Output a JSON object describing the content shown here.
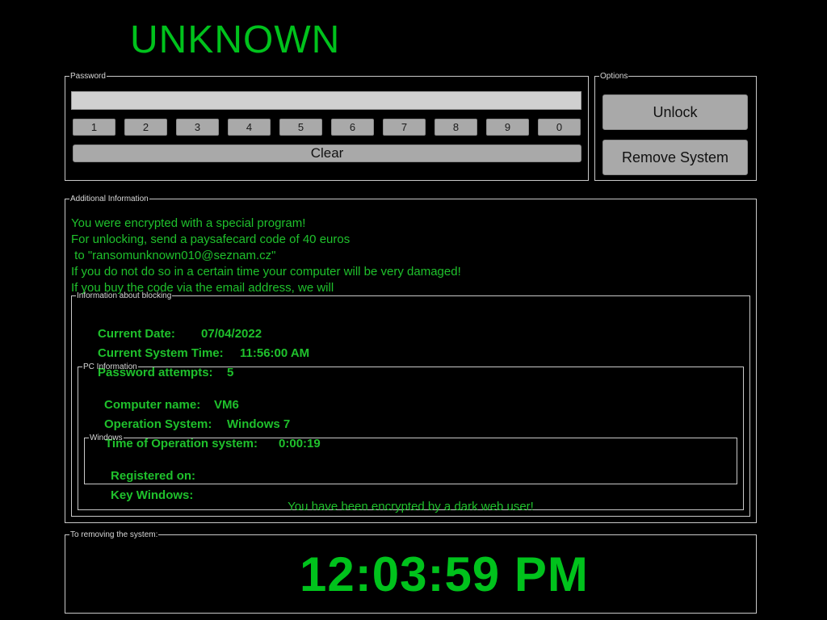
{
  "title": "UNKNOWN",
  "password": {
    "legend": "Password",
    "value": "",
    "digits": [
      "1",
      "2",
      "3",
      "4",
      "5",
      "6",
      "7",
      "8",
      "9",
      "0"
    ],
    "clear_label": "Clear"
  },
  "options": {
    "legend": "Options",
    "unlock_label": "Unlock",
    "remove_label": "Remove System"
  },
  "additional": {
    "legend": "Additional Information",
    "lines": [
      "You were encrypted with a special program!",
      "For unlocking, send a paysafecard code of 40 euros",
      " to \"ransomunknown010@seznam.cz\"",
      "If you do not do so in a certain time your computer will be very damaged!",
      "If you buy the code via the email address, we will"
    ]
  },
  "blocking": {
    "legend": "Information about blocking",
    "current_date_label": "Current Date:",
    "current_date": "07/04/2022",
    "system_time_label": "Current System Time:",
    "system_time": "11:56:00 AM",
    "attempts_label": "Password attempts:",
    "attempts": "5"
  },
  "pc": {
    "legend": "PC Information",
    "computer_name_label": "Computer name:",
    "computer_name": "VM6",
    "os_label": "Operation System:",
    "os": "Windows 7",
    "uptime_label": "Time of Operation system:",
    "uptime": "0:00:19"
  },
  "windows": {
    "legend": "Windows",
    "registered_label": "Registered on:",
    "registered_value": "",
    "key_label": "Key Windows:",
    "key_value": ""
  },
  "dark_web_message": "You have been encrypted by a dark web user!",
  "removal": {
    "legend": "To removing the system:",
    "clock": "12:03:59 PM"
  },
  "colors": {
    "background": "#000000",
    "accent_green": "#00c21c",
    "text_green": "#1fc12c",
    "button_gray": "#a9a9a9",
    "border": "#c9c9c9"
  }
}
